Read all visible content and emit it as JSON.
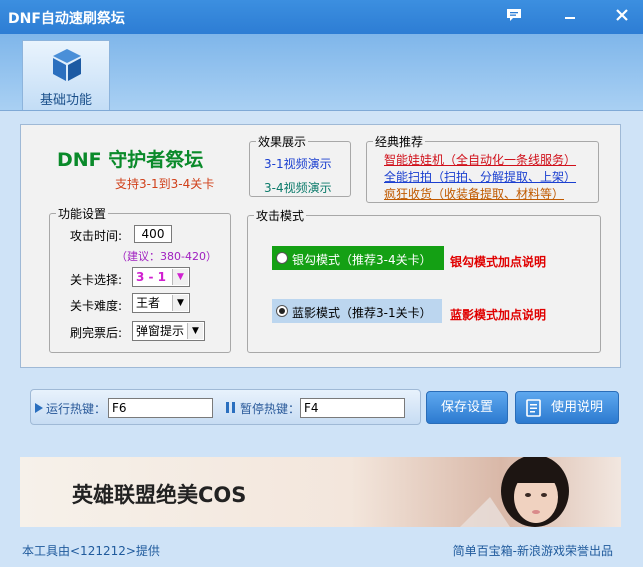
{
  "window": {
    "title": "DNF自动速刷祭坛"
  },
  "toolbar": {
    "basic_label": "基础功能"
  },
  "main": {
    "heading": "DNF 守护者祭坛",
    "subheading": "支持3-1到3-4关卡"
  },
  "effects": {
    "legend": "效果展示",
    "link1": "3-1视频演示",
    "link2": "3-4视频演示"
  },
  "recommend": {
    "legend": "经典推荐",
    "item1": "智能娃娃机（全自动化一条线服务）",
    "item2": "全能扫拍（扫拍、分解提取、上架）",
    "item3": "疯狂收货（收装备提取、材料等）"
  },
  "settings": {
    "legend": "功能设置",
    "attack_time_label": "攻击时间:",
    "attack_time_value": "400",
    "suggestion": "（建议：380-420）",
    "level_label": "关卡选择:",
    "level_value": "3 - 1",
    "difficulty_label": "关卡难度:",
    "difficulty_value": "王者",
    "after_label": "刷完票后:",
    "after_value": "弹窗提示"
  },
  "attack": {
    "legend": "攻击模式",
    "mode1_label": "银勾模式（推荐3-4关卡）",
    "mode1_note": "银勾模式加点说明",
    "mode2_label": "蓝影模式（推荐3-1关卡）",
    "mode2_note": "蓝影模式加点说明"
  },
  "hotkeys": {
    "run_label": "运行热键：",
    "run_value": "F6",
    "pause_label": "暂停热键：",
    "pause_value": "F4"
  },
  "buttons": {
    "save": "保存设置",
    "help": "使用说明"
  },
  "banner": {
    "text": "英雄联盟绝美COS"
  },
  "footer": {
    "left": "本工具由<121212>提供",
    "right": "简单百宝箱-新浪游戏荣誉出品"
  },
  "colors": {
    "titlebar": "#2d7dd4",
    "heading_green": "#0a8a2a",
    "note_red": "#e00000",
    "link_blue": "#1a3fd0"
  }
}
